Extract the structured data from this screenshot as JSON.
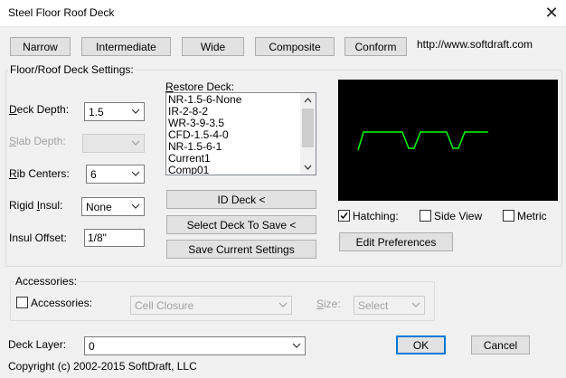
{
  "window": {
    "title": "Steel Floor Roof Deck"
  },
  "top_buttons": [
    "Narrow",
    "Intermediate",
    "Wide",
    "Composite",
    "Conform"
  ],
  "url": "http://www.softdraft.com",
  "settings_group": "Floor/Roof Deck Settings:",
  "deck_depth": {
    "label_pre": "",
    "label_key": "D",
    "label_post": "eck Depth:",
    "value": "1.5"
  },
  "slab_depth": {
    "label_pre": "",
    "label_key": "S",
    "label_post": "lab Depth:",
    "value": ""
  },
  "rib_centers": {
    "label_pre": "",
    "label_key": "R",
    "label_post": "ib Centers:",
    "value": "6"
  },
  "rigid_insul": {
    "label_pre": "Rigid ",
    "label_key": "I",
    "label_post": "nsul:",
    "value": "None"
  },
  "insul_offset": {
    "label": "Insul Offset:",
    "value": "1/8\""
  },
  "restore_deck": {
    "label_key": "R",
    "label_post": "estore Deck:",
    "items": [
      "NR-1.5-6-None",
      "IR-2-8-2",
      "WR-3-9-3.5",
      "CFD-1.5-4-0",
      "NR-1.5-6-1",
      "Current1",
      "Comp01"
    ]
  },
  "action_buttons": {
    "id_deck": "ID Deck <",
    "select_deck": "Select Deck To Save <",
    "save_settings": "Save Current Settings"
  },
  "options": {
    "hatching": "Hatching:",
    "side_view": "Side View",
    "metric": "Metric",
    "hatching_checked": true,
    "side_view_checked": false,
    "metric_checked": false
  },
  "edit_preferences": "Edit Preferences",
  "accessories_group": "Accessories:",
  "accessories": {
    "label": "Accessories:",
    "checked": false,
    "closure": "Cell Closure",
    "size_label_key": "S",
    "size_label_post": "ize:",
    "size_value": "Select"
  },
  "deck_layer": {
    "label": "Deck Layer:",
    "value": "0"
  },
  "ok": "OK",
  "cancel": "Cancel",
  "copyright": "Copyright (c) 2002-2015 SoftDraft, LLC",
  "colors": {
    "profile": "#00ff00",
    "preview_bg": "#000000",
    "accent": "#0078d7"
  }
}
